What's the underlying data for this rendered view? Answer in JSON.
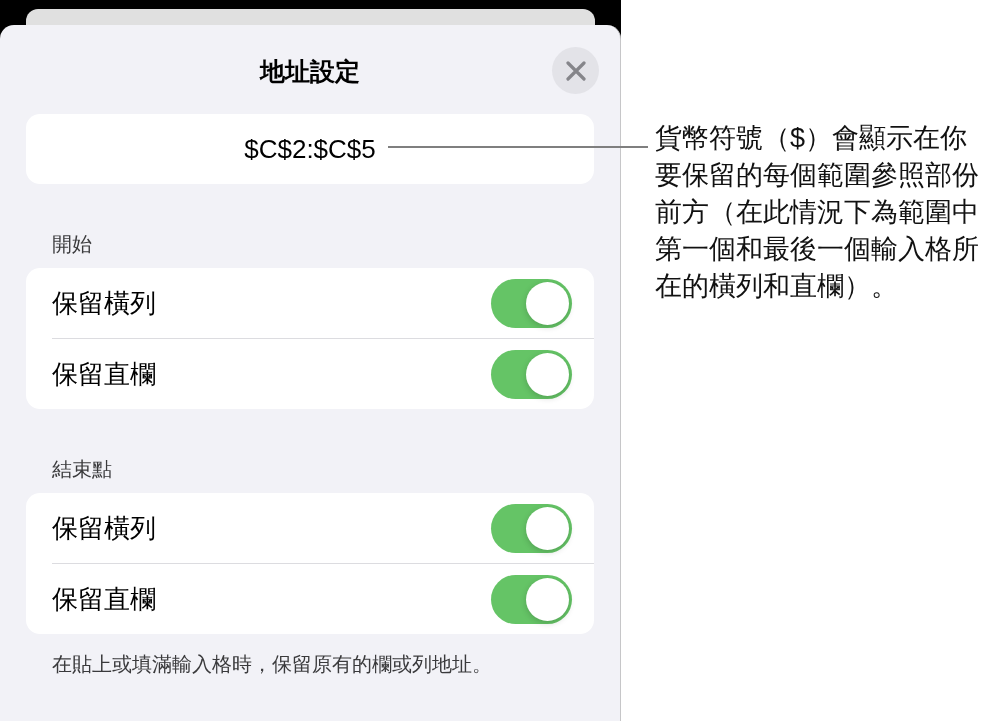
{
  "sheet": {
    "title": "地址設定",
    "address": "$C$2:$C$5",
    "sections": [
      {
        "header": "開始",
        "rows": [
          {
            "label": "保留橫列",
            "on": true
          },
          {
            "label": "保留直欄",
            "on": true
          }
        ]
      },
      {
        "header": "結束點",
        "rows": [
          {
            "label": "保留橫列",
            "on": true
          },
          {
            "label": "保留直欄",
            "on": true
          }
        ]
      }
    ],
    "footer": "在貼上或填滿輸入格時，保留原有的欄或列地址。"
  },
  "callout": {
    "text": "貨幣符號（$）會顯示在你要保留的每個範圍參照部份前方（在此情況下為範圍中第一個和最後一個輸入格所在的橫列和直欄）。"
  }
}
